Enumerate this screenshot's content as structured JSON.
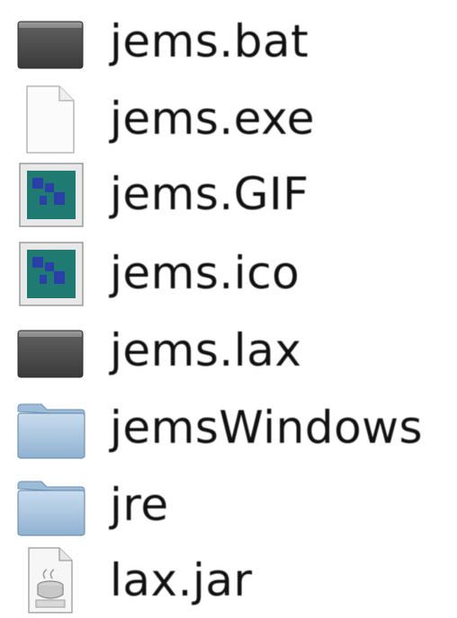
{
  "files": [
    {
      "name": "jems.bat",
      "icon": "terminal-icon"
    },
    {
      "name": "jems.exe",
      "icon": "document-icon"
    },
    {
      "name": "jems.GIF",
      "icon": "image-icon"
    },
    {
      "name": "jems.ico",
      "icon": "image-icon"
    },
    {
      "name": "jems.lax",
      "icon": "terminal-icon"
    },
    {
      "name": "jemsWindows",
      "icon": "folder-icon"
    },
    {
      "name": "jre",
      "icon": "folder-icon"
    },
    {
      "name": "lax.jar",
      "icon": "java-jar-icon"
    }
  ],
  "colors": {
    "folder": "#a9c8e2",
    "terminal": "#4a4a4a",
    "image_bg": "#1f7a72",
    "image_fg": "#2b3fa8",
    "text": "#111111"
  }
}
